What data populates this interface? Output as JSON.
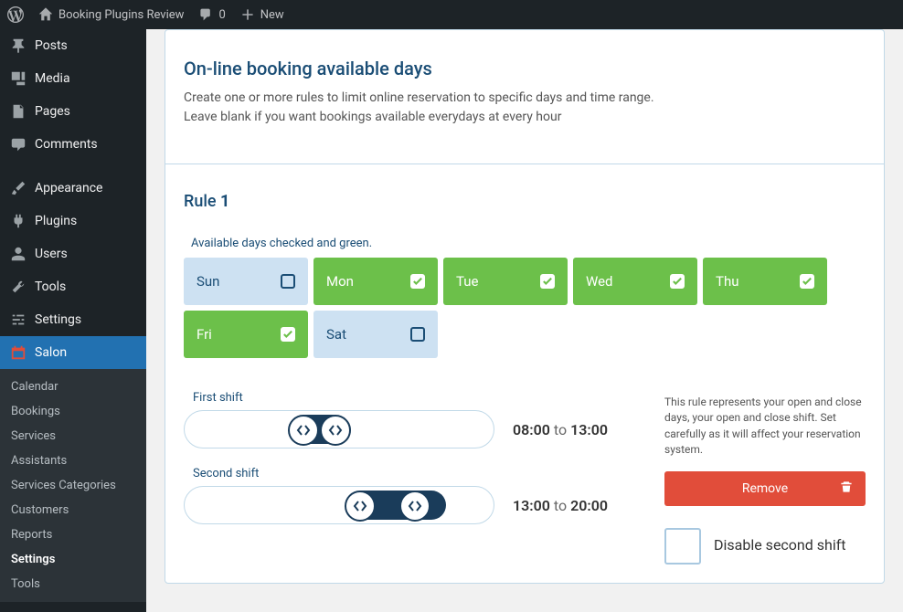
{
  "topbar": {
    "site_name": "Booking Plugins Review",
    "comments_count": "0",
    "new_label": "New"
  },
  "sidebar": {
    "items": [
      {
        "icon": "pin",
        "label": "Posts"
      },
      {
        "icon": "media",
        "label": "Media"
      },
      {
        "icon": "page",
        "label": "Pages"
      },
      {
        "icon": "comment",
        "label": "Comments"
      }
    ],
    "items2": [
      {
        "icon": "brush",
        "label": "Appearance"
      },
      {
        "icon": "plug",
        "label": "Plugins"
      },
      {
        "icon": "user",
        "label": "Users"
      },
      {
        "icon": "wrench",
        "label": "Tools"
      },
      {
        "icon": "sliders",
        "label": "Settings"
      }
    ],
    "active": {
      "icon": "calendar",
      "label": "Salon"
    },
    "submenu": [
      "Calendar",
      "Bookings",
      "Services",
      "Assistants",
      "Services Categories",
      "Customers",
      "Reports",
      "Settings",
      "Tools"
    ],
    "submenu_active": "Settings"
  },
  "header": {
    "title": "On-line booking available days",
    "line1": "Create one or more rules to limit online reservation to specific days and time range.",
    "line2": "Leave blank if you want bookings available everydays at every hour"
  },
  "rule": {
    "title_prefix": "Rule ",
    "number": "1",
    "days_hint": "Available days checked and green.",
    "days": [
      {
        "label": "Sun",
        "on": false
      },
      {
        "label": "Mon",
        "on": true
      },
      {
        "label": "Tue",
        "on": true
      },
      {
        "label": "Wed",
        "on": true
      },
      {
        "label": "Thu",
        "on": true
      },
      {
        "label": "Fri",
        "on": true
      },
      {
        "label": "Sat",
        "on": false
      }
    ],
    "shift1_label": "First shift",
    "shift1_from": "08:00",
    "shift1_to": "13:00",
    "shift2_label": "Second shift",
    "shift2_from": "13:00",
    "shift2_to": "20:00",
    "to_word": " to ",
    "description": "This rule represents your open and close days, your open and close shift. Set carefully as it will affect your reservation system.",
    "remove_label": "Remove",
    "disable_label": "Disable second shift"
  },
  "slider_positions": {
    "shift1_range_left": 117,
    "shift1_range_width": 60,
    "shift1_h1": 113,
    "shift1_h2": 148,
    "shift2_range_left": 178,
    "shift2_range_width": 108,
    "shift2_h1": 175,
    "shift2_h2": 235
  }
}
